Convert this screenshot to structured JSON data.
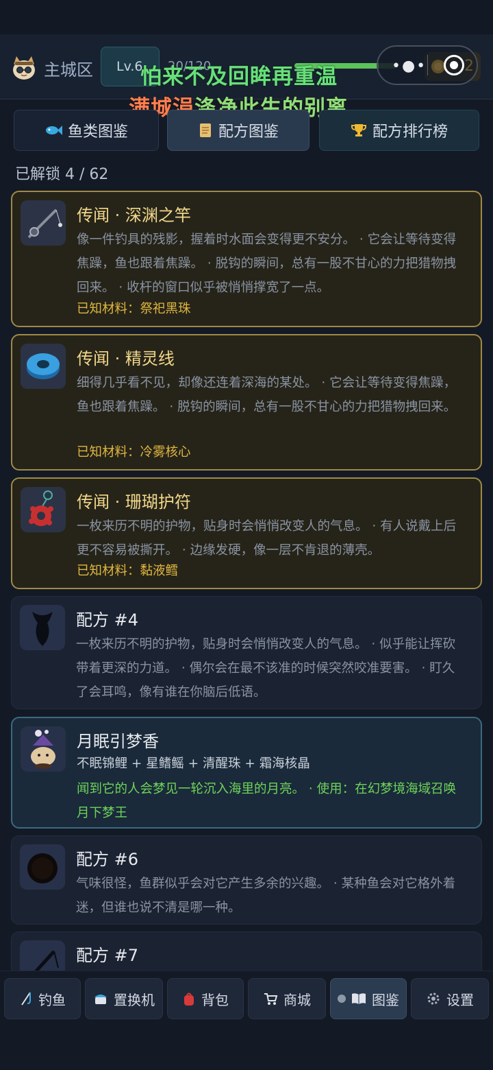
{
  "header": {
    "area_name": "主城区",
    "level": "Lv.6",
    "xp_text": "20/120",
    "coins": "2",
    "xp_progress": 0.82
  },
  "lyrics": {
    "line1": "怕来不及回眸再重温",
    "line2_a": "满城涓",
    "line2_b": "涤净此生的别离"
  },
  "tabs": [
    {
      "label": "鱼类图鉴",
      "icon": "fish-icon"
    },
    {
      "label": "配方图鉴",
      "icon": "scroll-icon"
    },
    {
      "label": "配方排行榜",
      "icon": "trophy-icon"
    }
  ],
  "unlocked_text": "已解锁 4 / 62",
  "cards": [
    {
      "title": "传闻 · 深渊之竿",
      "desc": "像一件钓具的残影，握着时水面会变得更不安分。 · 它会让等待变得焦躁，鱼也跟着焦躁。 · 脱钩的瞬间，总有一股不甘心的力把猎物拽回来。 · 收杆的窗口似乎被悄悄撑宽了一点。",
      "materials": "已知材料：祭祀黑珠"
    },
    {
      "title": "传闻 · 精灵线",
      "desc": "细得几乎看不见，却像还连着深海的某处。 · 它会让等待变得焦躁，鱼也跟着焦躁。 · 脱钩的瞬间，总有一股不甘心的力把猎物拽回来。",
      "materials": "已知材料：冷雾核心"
    },
    {
      "title": "传闻 · 珊瑚护符",
      "desc": "一枚来历不明的护物，贴身时会悄悄改变人的气息。 · 有人说戴上后更不容易被撕开。 · 边缘发硬，像一层不肯退的薄壳。",
      "materials": "已知材料：黏液鳕"
    },
    {
      "title": "配方 #4",
      "desc": "一枚来历不明的护物，贴身时会悄悄改变人的气息。 · 似乎能让挥砍带着更深的力道。 · 偶尔会在最不该准的时候突然咬准要害。 · 盯久了会耳鸣，像有谁在你脑后低语。"
    },
    {
      "title": "月眠引梦香",
      "ingredients": "不眠锦鲤 + 星鳍鳐 + 清醒珠 + 霜海核晶",
      "desc": "闻到它的人会梦见一轮沉入海里的月亮。 · 使用：在幻梦境海域召唤月下梦王"
    },
    {
      "title": "配方 #6",
      "desc": "气味很怪，鱼群似乎会对它产生多余的兴趣。 · 某种鱼会对它格外着迷，但谁也说不清是哪一种。"
    },
    {
      "title": "配方 #7"
    }
  ],
  "nav": [
    {
      "label": "钓鱼",
      "icon": "fishing-icon"
    },
    {
      "label": "置换机",
      "icon": "machine-icon"
    },
    {
      "label": "背包",
      "icon": "backpack-icon"
    },
    {
      "label": "商城",
      "icon": "cart-icon"
    },
    {
      "label": "图鉴",
      "icon": "book-icon"
    },
    {
      "label": "设置",
      "icon": "gear-icon"
    }
  ],
  "colors": {
    "background": "#131a26",
    "gold_border": "#a08a45",
    "gold_text": "#e0b640",
    "teal_border": "#3c6a80",
    "green_text": "#6ed45a"
  }
}
